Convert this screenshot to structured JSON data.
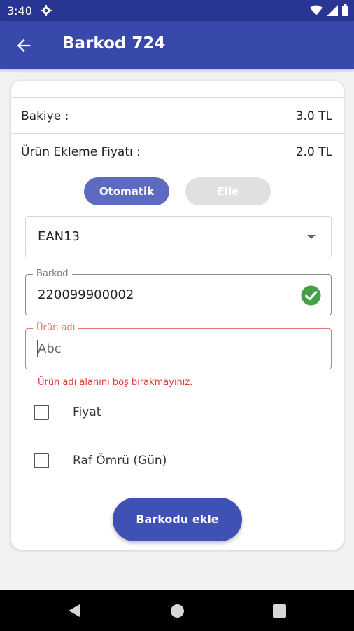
{
  "status_bar": {
    "time": "3:40",
    "icons": [
      "gear-icon",
      "wifi-icon",
      "signal-icon",
      "battery-icon"
    ]
  },
  "app_bar": {
    "title": "Barkod 724",
    "back_icon": "arrow-left-icon"
  },
  "balance": {
    "label": "Bakiye :",
    "value": "3.0 TL"
  },
  "price": {
    "label": "Ürün Ekleme Fiyatı :",
    "value": "2.0 TL"
  },
  "mode_toggle": {
    "auto_label": "Otomatik",
    "manual_label": "Elle",
    "selected": "Otomatik"
  },
  "barcode_type": {
    "selected": "EAN13"
  },
  "barcode_field": {
    "label": "Barkod",
    "value": "220099900002",
    "status_icon": "check-circle-icon"
  },
  "name_field": {
    "label": "Ürün adı",
    "value": "Abc",
    "error": "Ürün adı alanını boş bırakmayınız."
  },
  "options": [
    {
      "label": "Fiyat",
      "checked": false
    },
    {
      "label": "Raf Ömrü (Gün)",
      "checked": false
    }
  ],
  "submit": {
    "label": "Barkodu ekle"
  },
  "colors": {
    "primary": "#3949ab",
    "status_bar": "#283593",
    "accent": "#5c6bc0",
    "error": "#e53935",
    "success": "#43a047"
  }
}
